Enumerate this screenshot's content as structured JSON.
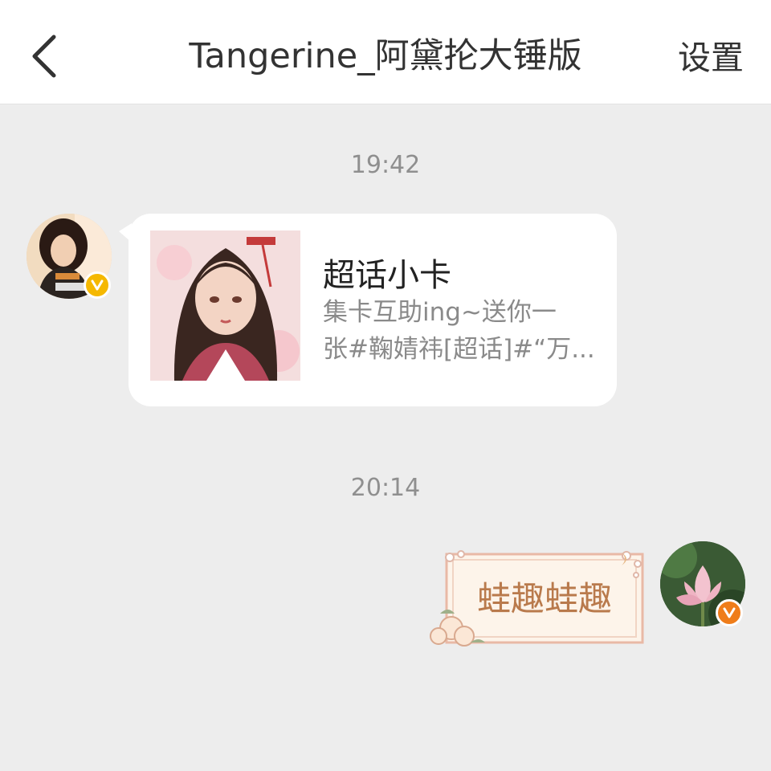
{
  "header": {
    "title": "Tangerine_阿黛抡大锤版",
    "settings_label": "设置",
    "back_icon": "chevron-left-icon"
  },
  "messages": [
    {
      "time": "19:42",
      "from": "contact",
      "type": "card",
      "card": {
        "title": "超话小卡",
        "desc_line1": "集卡互助ing~送你一",
        "desc_line2": "张#鞠婧祎[超话]#“万..."
      },
      "avatar_badge": "v-badge-icon"
    },
    {
      "time": "20:14",
      "from": "me",
      "type": "text",
      "text": "蛙趣蛙趣",
      "avatar_badge": "v-badge-icon"
    }
  ],
  "colors": {
    "background": "#ededed",
    "header": "#ffffff",
    "contact_badge": "#f5b800",
    "me_badge": "#ef7d1a",
    "sticker_text": "#b97a4c"
  }
}
